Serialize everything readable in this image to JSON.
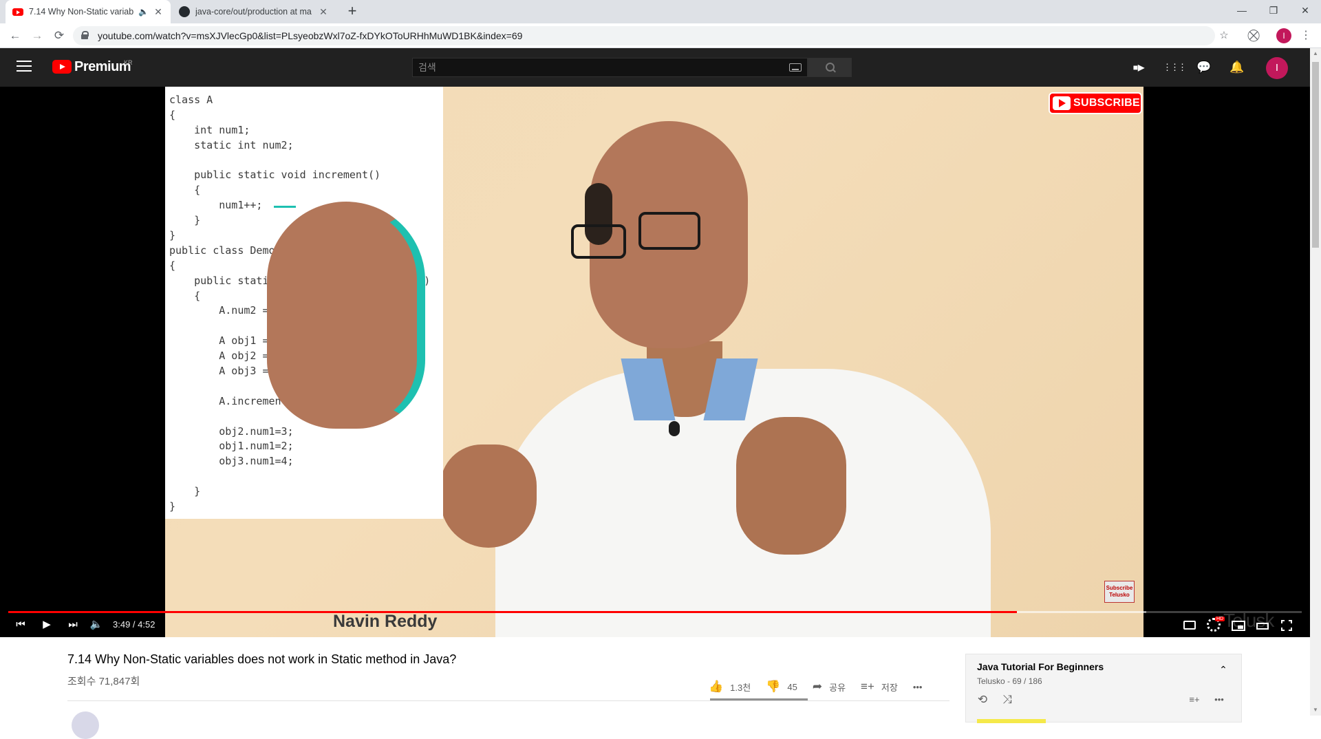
{
  "browser": {
    "tabs": [
      {
        "title": "7.14 Why Non-Static variab",
        "favicon": "youtube-icon",
        "audio": "🔈",
        "active": true
      },
      {
        "title": "java-core/out/production at ma",
        "favicon": "github-icon",
        "active": false
      }
    ],
    "new_tab": "+",
    "close_glyph": "✕",
    "window": {
      "minimize": "—",
      "restore": "❐",
      "close": "✕"
    },
    "url": "youtube.com/watch?v=msXJVlecGp0&list=PLsyeobzWxl7oZ-fxDYkOToURHhMuWD1BK&index=69",
    "nav": {
      "back": "←",
      "forward": "→",
      "reload": "⟳"
    },
    "profile_initial": "I",
    "menu_glyph": "⋮",
    "star_glyph": "☆",
    "ext_glyph": "⛒"
  },
  "youtube": {
    "logo_text": "Premium",
    "region": "KR",
    "search_placeholder": "검색",
    "user_initial": "I",
    "icons": {
      "create": "■▶",
      "apps": "⋮⋮⋮",
      "messages": "💬",
      "notifications": "🔔"
    }
  },
  "video": {
    "code_lines": [
      "class A",
      "{",
      "    int num1;",
      "    static int num2;",
      "",
      "    public static void increment()",
      "    {",
      "        num1++;",
      "    }",
      "}",
      "public class Demo",
      "{",
      "    public static void main(String args[])",
      "    {",
      "        A.num2 = 5;",
      "",
      "        A obj1 = new A();",
      "        A obj2 = new A();",
      "        A obj3 = new A();",
      "",
      "        A.increment();",
      "",
      "        obj2.num1=3;",
      "        obj1.num1=2;",
      "        obj3.num1=4;",
      "",
      "    }",
      "}"
    ],
    "subscribe_badge": "SUBSCRIBE",
    "watermark": "Subscribe Telusko",
    "presenter_name": "Navin Reddy",
    "brand": "Telusk",
    "progress_fraction": 0.78,
    "buffered_fraction": 0.88,
    "time": "3:49 / 4:52",
    "controls": {
      "prev": "⏮",
      "play": "▶",
      "next": "⏭",
      "volume": "🔈",
      "hd": "HD"
    }
  },
  "details": {
    "title": "7.14 Why Non-Static variables does not work in Static method in Java?",
    "views": "조회수 71,847회",
    "likes": "1.3천",
    "dislikes": "45",
    "share": "공유",
    "save": "저장",
    "more": "•••",
    "like_ratio": 0.97,
    "icons": {
      "like": "👍",
      "dislike": "👎",
      "share": "➦",
      "save": "≡+"
    }
  },
  "playlist": {
    "title": "Java Tutorial For Beginners",
    "subtitle": "Telusko - 69 / 186",
    "chevron": "⌃",
    "icons": {
      "loop": "⟲",
      "shuffle": "⤨",
      "add": "≡+",
      "more": "•••"
    }
  },
  "colors": {
    "youtube_red": "#ff0000",
    "masthead": "#212121",
    "code_keyword": "#b4569e",
    "arrow": "#1ec0b0"
  }
}
